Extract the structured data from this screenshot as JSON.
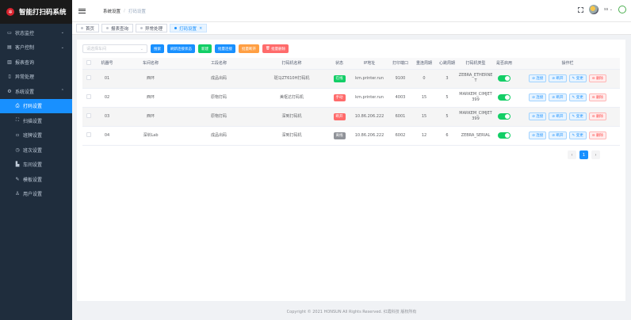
{
  "app": {
    "title": "智能打扫码系统",
    "logo_icon": "gear-logo-icon"
  },
  "sidebar": {
    "items": [
      {
        "label": "状态监控",
        "icon": "monitor-icon"
      },
      {
        "label": "客户控制",
        "icon": "calendar-icon"
      },
      {
        "label": "报表查询",
        "icon": "chart-icon"
      },
      {
        "label": "异常处理",
        "icon": "document-icon"
      },
      {
        "label": "系统设置",
        "icon": "gear-icon"
      }
    ],
    "subitems": [
      {
        "label": "打码设置",
        "icon": "printer-icon",
        "active": true
      },
      {
        "label": "扫描设置",
        "icon": "scan-icon"
      },
      {
        "label": "班牌设置",
        "icon": "clipboard-icon"
      },
      {
        "label": "班次设置",
        "icon": "clock-icon"
      },
      {
        "label": "车间设置",
        "icon": "building-icon"
      },
      {
        "label": "模板设置",
        "icon": "edit-icon"
      },
      {
        "label": "用户设置",
        "icon": "user-icon"
      }
    ]
  },
  "header": {
    "breadcrumb": [
      "系统设置",
      "打码设置"
    ],
    "user_name": "ss"
  },
  "tags": [
    {
      "label": "首页",
      "active": false
    },
    {
      "label": "报表查询",
      "active": false
    },
    {
      "label": "异常处理",
      "active": false
    },
    {
      "label": "打码设置",
      "active": true
    }
  ],
  "toolbar": {
    "select_placeholder": "请选择车间",
    "buttons": [
      {
        "label": "搜索",
        "color": "#1890ff"
      },
      {
        "label": "刷新连接状态",
        "color": "#1890ff"
      },
      {
        "label": "新建",
        "color": "#13ce66"
      },
      {
        "label": "批量连接",
        "color": "#1890ff"
      },
      {
        "label": "批量断开",
        "color": "#ff9f43"
      },
      {
        "label": "批量删除",
        "color": "#ff6b6b"
      }
    ]
  },
  "table": {
    "columns": [
      "机器号",
      "车间名称",
      "工段名称",
      "打码机名称",
      "状态",
      "IP地址",
      "打印端口",
      "重连周期",
      "心跳周期",
      "打码机类型",
      "是否启用",
      "操作栏"
    ],
    "rows": [
      {
        "id": "01",
        "workshop": "西环",
        "section": "成品出码",
        "printer": "斑马ZT610H打码机",
        "status": "在线",
        "status_color": "#13ce66",
        "ip": "km.printer.run",
        "port": "9100",
        "reconnect": "0",
        "heartbeat": "3",
        "type": "ZEBRA_ETHERNET",
        "enabled": true
      },
      {
        "id": "02",
        "workshop": "西环",
        "section": "原物打码",
        "printer": "美枢达打码机",
        "status": "手动",
        "status_color": "#ff6b6b",
        "ip": "km.printer.run",
        "port": "4003",
        "reconnect": "15",
        "heartbeat": "5",
        "type": "MARKEM_CIMJET399",
        "enabled": true
      },
      {
        "id": "03",
        "workshop": "西环",
        "section": "原物打码",
        "printer": "深到打码机",
        "status": "断开",
        "status_color": "#ff6b6b",
        "ip": "10.86.206.222",
        "port": "6001",
        "reconnect": "15",
        "heartbeat": "5",
        "type": "MARKEM_CIMJET399",
        "enabled": true
      },
      {
        "id": "04",
        "workshop": "深圳Lab",
        "section": "成品出码",
        "printer": "深到打码机",
        "status": "离线",
        "status_color": "#909399",
        "ip": "10.86.206.222",
        "port": "6002",
        "reconnect": "12",
        "heartbeat": "6",
        "type": "ZEBRA_SERIAL",
        "enabled": true
      }
    ],
    "ops": [
      "连接",
      "断开",
      "变更",
      "删除"
    ]
  },
  "pager": {
    "current": "1"
  },
  "footer": {
    "text": "Copyright © 2021 HONSUN All Rights Reserved. 红霞科技 版权所有"
  }
}
